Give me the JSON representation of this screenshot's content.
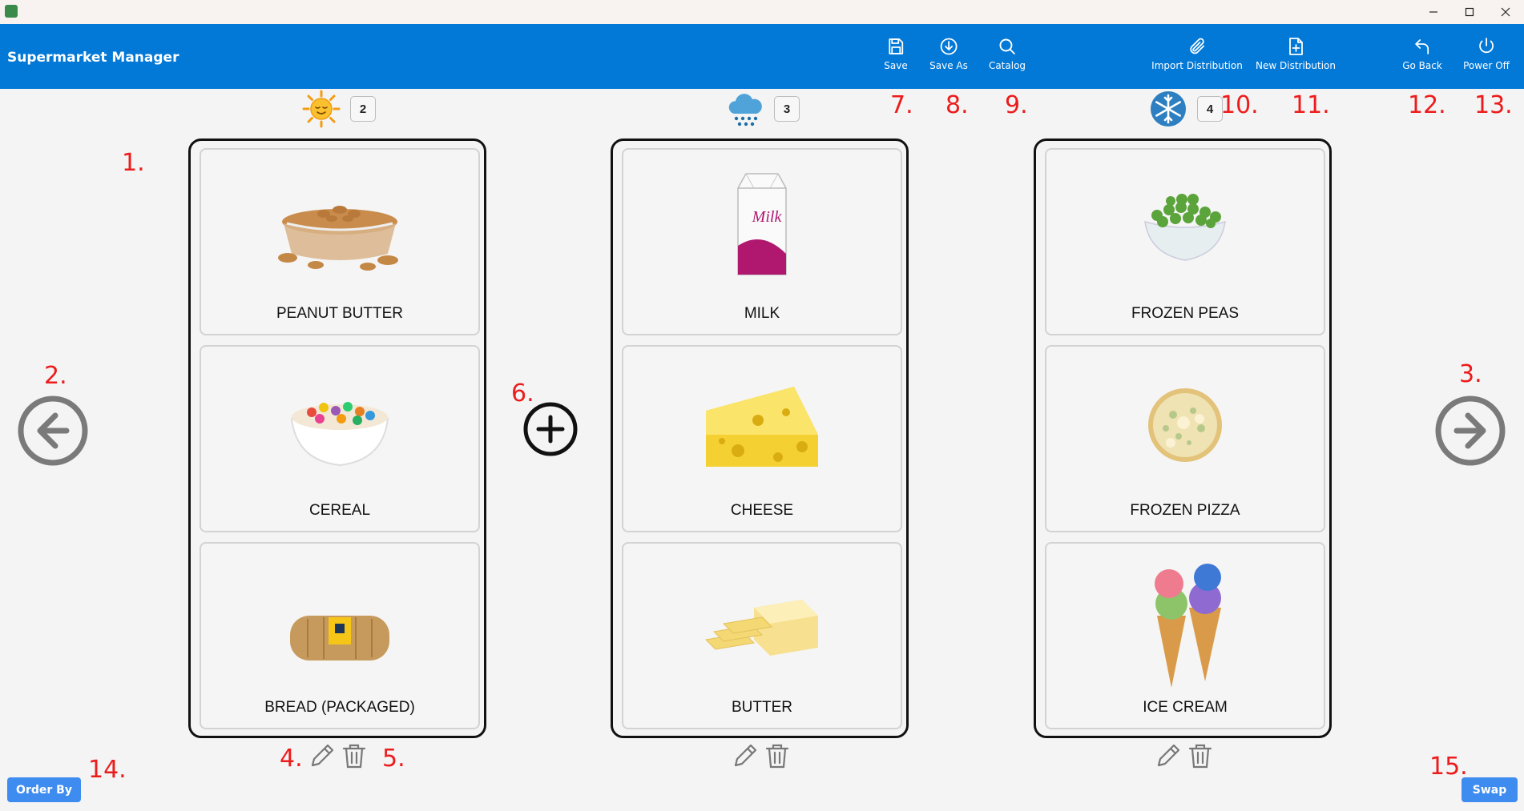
{
  "app": {
    "title": "Supermarket Manager"
  },
  "toolbar": {
    "save": "Save",
    "save_as": "Save As",
    "catalog": "Catalog",
    "import_distribution": "Import Distribution",
    "new_distribution": "New Distribution",
    "go_back": "Go Back",
    "power_off": "Power Off"
  },
  "annotations": [
    "1.",
    "2.",
    "3.",
    "4.",
    "5.",
    "6.",
    "7.",
    "8.",
    "9.",
    "10.",
    "11.",
    "12.",
    "13.",
    "14.",
    "15."
  ],
  "columns": [
    {
      "icon": "sun-icon",
      "count": "2",
      "items": [
        "PEANUT BUTTER",
        "CEREAL",
        "BREAD (PACKAGED)"
      ]
    },
    {
      "icon": "snow-cloud-icon",
      "count": "3",
      "items": [
        "MILK",
        "CHEESE",
        "BUTTER"
      ]
    },
    {
      "icon": "snowflake-icon",
      "count": "4",
      "items": [
        "FROZEN PEAS",
        "FROZEN PIZZA",
        "ICE CREAM"
      ]
    }
  ],
  "footer": {
    "order_by": "Order By",
    "swap": "Swap"
  },
  "colors": {
    "accent": "#0278d7",
    "annotation": "#ec1c1c",
    "pill": "#3f8cf0"
  }
}
